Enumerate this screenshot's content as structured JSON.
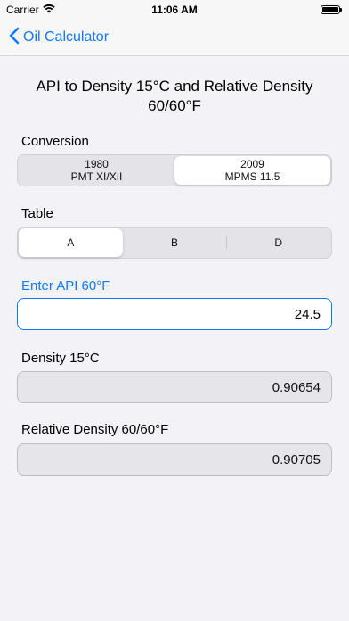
{
  "status_bar": {
    "carrier": "Carrier",
    "time": "11:06 AM"
  },
  "nav": {
    "back_label": "Oil Calculator"
  },
  "page": {
    "title": "API to Density 15°C and Relative Density 60/60°F"
  },
  "conversion": {
    "label": "Conversion",
    "options": [
      {
        "line1": "1980",
        "line2": "PMT XI/XII"
      },
      {
        "line1": "2009",
        "line2": "MPMS 11.5"
      }
    ],
    "selected_index": 1
  },
  "table": {
    "label": "Table",
    "options": [
      "A",
      "B",
      "D"
    ],
    "selected_index": 0
  },
  "api_input": {
    "label": "Enter API 60°F",
    "value": "24.5"
  },
  "density_15c": {
    "label": "Density 15°C",
    "value": "0.90654"
  },
  "relative_density": {
    "label": "Relative Density 60/60°F",
    "value": "0.90705"
  },
  "colors": {
    "accent": "#0a7aff",
    "background": "#f2f2f7",
    "readonly_fill": "#e5e5ea"
  }
}
